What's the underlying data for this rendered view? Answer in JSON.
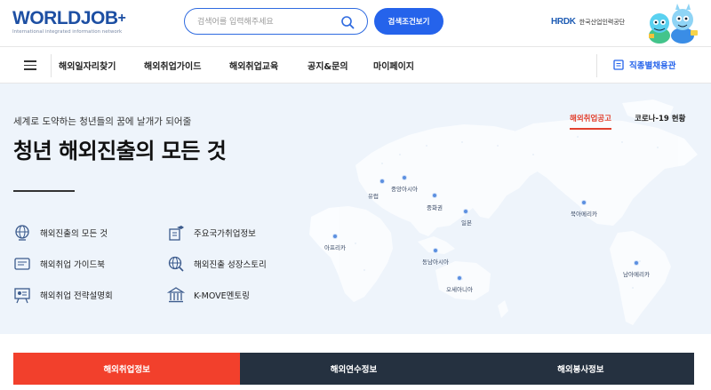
{
  "header": {
    "logo_text": "WORLDJOB",
    "logo_plus": "+",
    "logo_tagline": "International integrated information network",
    "search_placeholder": "검색어를 입력해주세요",
    "advanced_search_label": "검색조건보기",
    "hrdk_mark": "HRDK",
    "hrdk_org": "한국산업인력공단"
  },
  "nav": {
    "items": [
      {
        "label": "해외일자리찾기"
      },
      {
        "label": "해외취업가이드"
      },
      {
        "label": "해외취업교육"
      },
      {
        "label": "공지&문의"
      },
      {
        "label": "마이페이지"
      }
    ],
    "job_fair_label": "직종별채용관"
  },
  "hero": {
    "subtitle": "세계로 도약하는 청년들의 꿈에 날개가 되어줄",
    "title": "청년 해외진출의 모든 것",
    "quick_links": [
      {
        "label": "해외진출의 모든 것",
        "icon": "globe-icon"
      },
      {
        "label": "주요국가취업정보",
        "icon": "book-cap-icon"
      },
      {
        "label": "해외취업 가이드북",
        "icon": "guidebook-icon"
      },
      {
        "label": "해외진출 성장스토리",
        "icon": "globe-search-icon"
      },
      {
        "label": "해외취업 전략설명회",
        "icon": "presentation-icon"
      },
      {
        "label": "K-MOVE멘토링",
        "icon": "building-icon"
      }
    ],
    "tabs": [
      {
        "label": "해외취업공고",
        "active": true
      },
      {
        "label": "코로나-19 현황",
        "active": false
      }
    ],
    "regions": [
      {
        "label": "유럽"
      },
      {
        "label": "중앙아시아"
      },
      {
        "label": "중화권"
      },
      {
        "label": "일본"
      },
      {
        "label": "북아메리카"
      },
      {
        "label": "아프리카"
      },
      {
        "label": "동남아시아"
      },
      {
        "label": "오세아니아"
      },
      {
        "label": "남아메리카"
      }
    ]
  },
  "bottom_tabs": [
    {
      "label": "해외취업정보",
      "active": true
    },
    {
      "label": "해외연수정보",
      "active": false
    },
    {
      "label": "해외봉사정보",
      "active": false
    }
  ],
  "colors": {
    "brand_blue": "#2563eb",
    "accent_red": "#f2402c",
    "dark_tab": "#253140",
    "hero_bg": "#eef4fb"
  }
}
